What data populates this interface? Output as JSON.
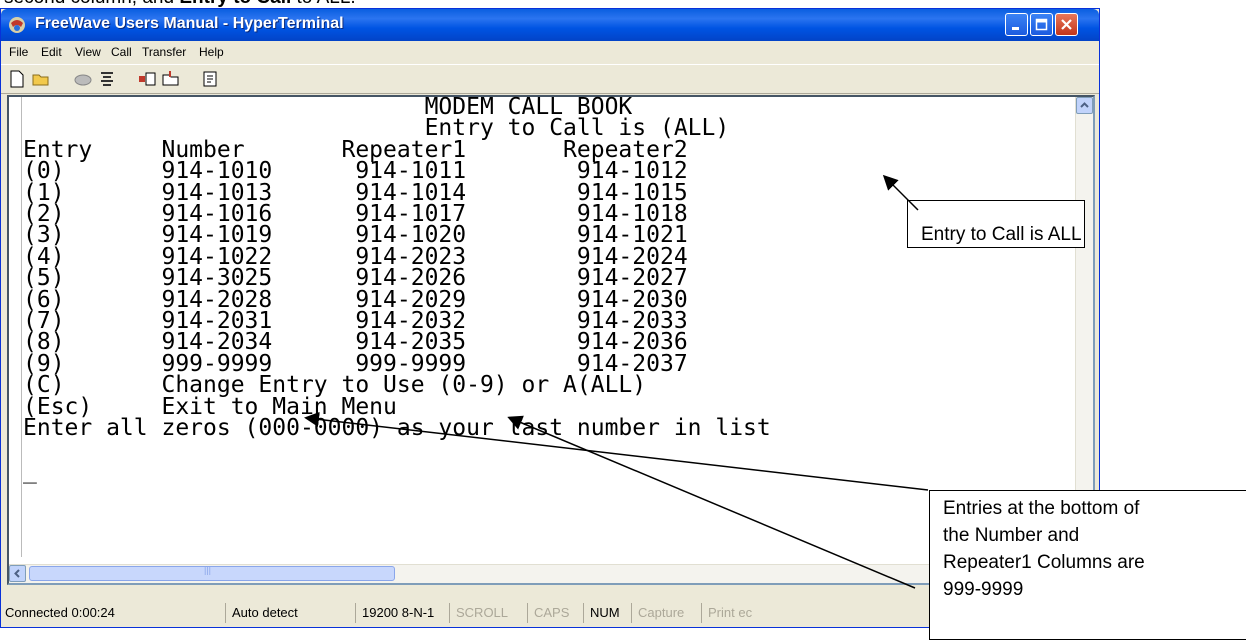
{
  "doc": {
    "lead": "second column, and ",
    "bold": "Entry to Call",
    "tail": " to ALL."
  },
  "window": {
    "title": "FreeWave Users Manual - HyperTerminal",
    "controls": [
      "minimize",
      "maximize",
      "close"
    ]
  },
  "menu": [
    "File",
    "Edit",
    "View",
    "Call",
    "Transfer",
    "Help"
  ],
  "toolbar": [
    "new-icon",
    "open-icon",
    "disconnect-icon",
    "dial-icon",
    "send-icon",
    "receive-icon",
    "properties-icon"
  ],
  "terminal": {
    "lines": [
      "                             MODEM CALL BOOK",
      "                             Entry to Call is (ALL)",
      "Entry     Number       Repeater1       Repeater2",
      "(0)       914-1010      914-1011        914-1012",
      "(1)       914-1013      914-1014        914-1015",
      "(2)       914-1016      914-1017        914-1018",
      "(3)       914-1019      914-1020        914-1021",
      "(4)       914-1022      914-2023        914-2024",
      "(5)       914-3025      914-2026        914-2027",
      "(6)       914-2028      914-2029        914-2030",
      "(7)       914-2031      914-2032        914-2033",
      "(8)       914-2034      914-2035        914-2036",
      "(9)       999-9999      999-9999        914-2037",
      "(C)       Change Entry to Use (0-9) or A(ALL)",
      "(Esc)     Exit to Main Menu",
      "Enter all zeros (000-0000) as your last number in list",
      "",
      "_"
    ]
  },
  "status": {
    "connected": "Connected 0:00:24",
    "detect": "Auto detect",
    "settings": "19200 8-N-1",
    "scroll": "SCROLL",
    "caps": "CAPS",
    "num": "NUM",
    "capture": "Capture",
    "print": "Print ec"
  },
  "callouts": {
    "entry_to_call": "Entry to Call is ALL",
    "entries_bottom": [
      "Entries at the bottom of",
      "the Number and",
      "Repeater1 Columns are",
      "999-9999"
    ]
  },
  "colors": {
    "title_bar": "#0054e3",
    "window_bg": "#ece9d8",
    "terminal_bg": "#ffffff"
  }
}
